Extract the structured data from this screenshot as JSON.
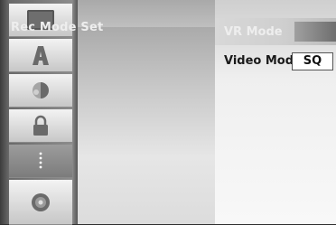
{
  "sidebar": {
    "items": [
      {
        "icon": "screen-icon",
        "selected": false
      },
      {
        "icon": "letter-a-icon",
        "selected": false
      },
      {
        "icon": "audio-icon",
        "selected": false
      },
      {
        "icon": "lock-icon",
        "selected": false
      },
      {
        "icon": "more-dots-icon",
        "selected": true
      },
      {
        "icon": "disc-icon",
        "selected": false
      }
    ]
  },
  "menu": {
    "title": "Rec Mode Set"
  },
  "settings": {
    "vr_mode_label": "VR Mode",
    "video_mode_label": "Video Mode",
    "video_mode_value": "SQ"
  }
}
